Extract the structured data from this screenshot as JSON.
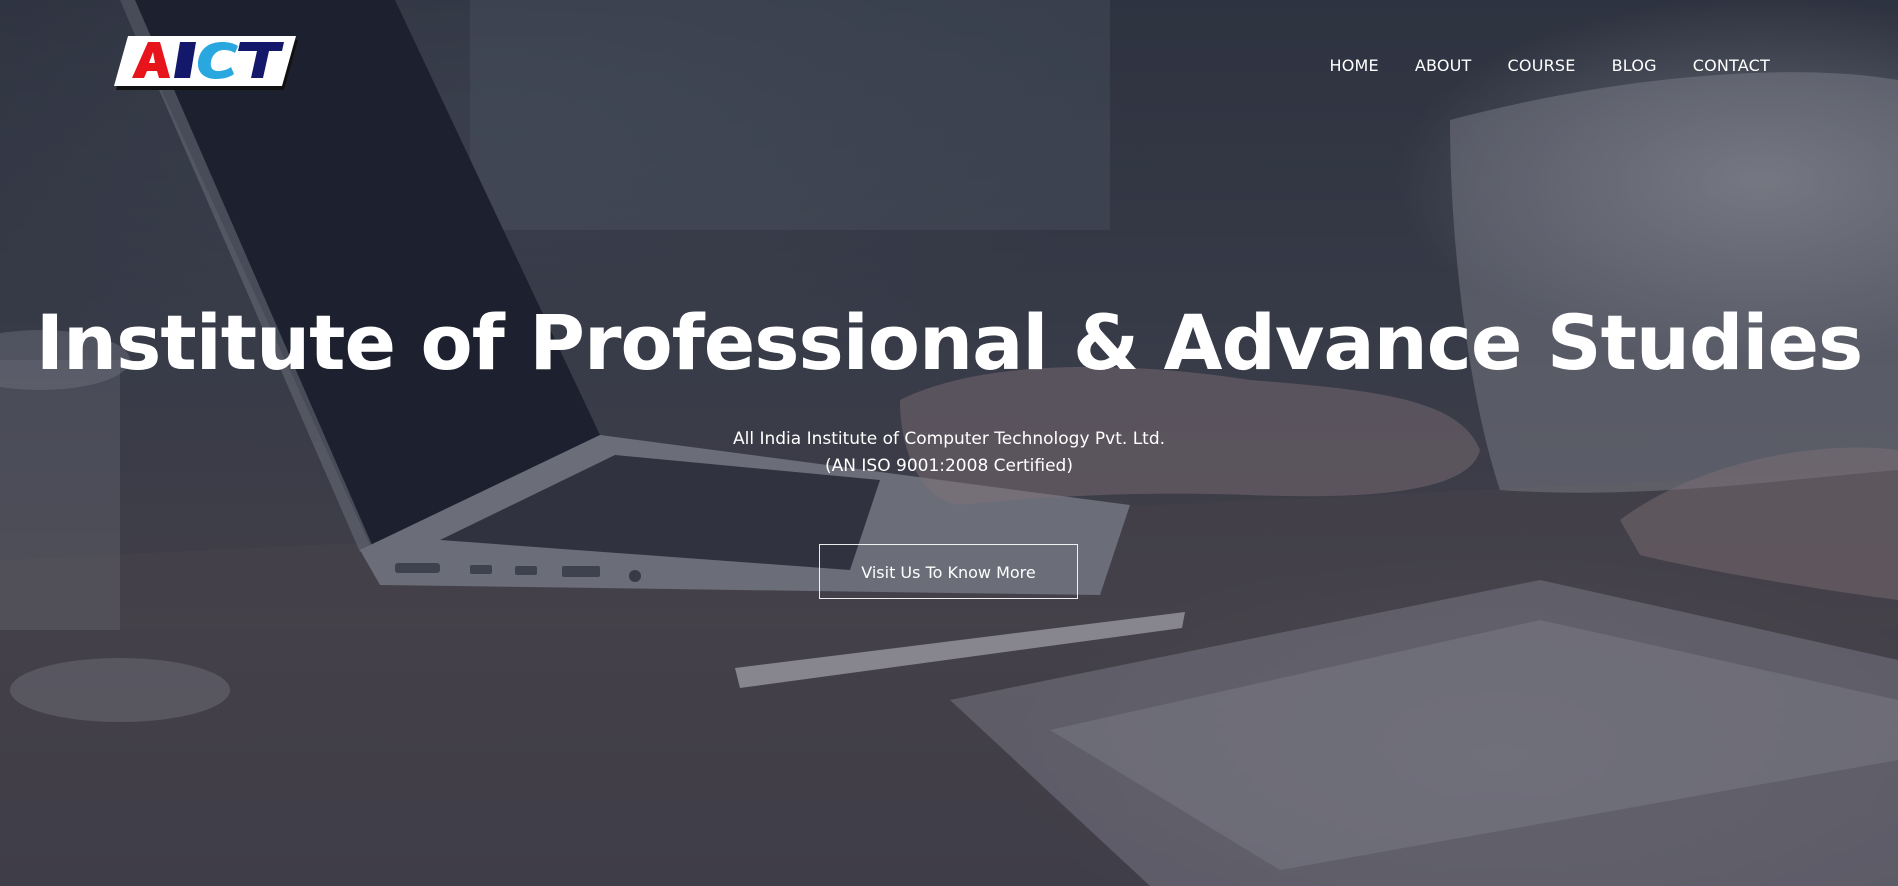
{
  "logo": {
    "text": "AICT",
    "alt": "AICT"
  },
  "nav": {
    "items": [
      {
        "label": "HOME"
      },
      {
        "label": "ABOUT"
      },
      {
        "label": "COURSE"
      },
      {
        "label": "BLOG"
      },
      {
        "label": "CONTACT"
      }
    ]
  },
  "hero": {
    "title": "Institute of Professional & Advance Studies",
    "subtitle_line1": "All India Institute of Computer Technology Pvt. Ltd.",
    "subtitle_line2": "(AN ISO 9001:2008 Certified)",
    "cta_label": "Visit Us To Know More",
    "background": "laptop-desk-photo"
  },
  "colors": {
    "text": "#ffffff",
    "logo_red": "#e8141c",
    "logo_navy": "#14186b",
    "logo_blue": "#29a8e0"
  }
}
